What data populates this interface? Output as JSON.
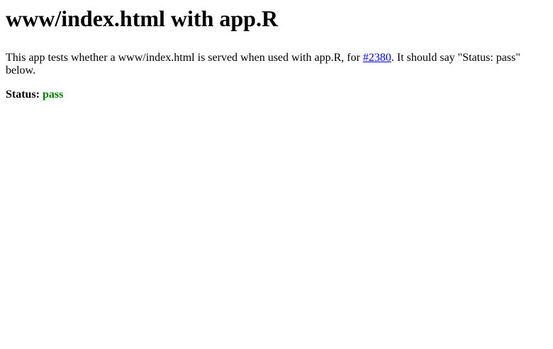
{
  "header": {
    "title": "www/index.html with app.R"
  },
  "intro": {
    "text_before": "This app tests whether a www/index.html is served when used with app.R, for ",
    "link_text": "#2380",
    "text_after": ". It should say \"Status: pass\" below."
  },
  "status": {
    "label": "Status:",
    "value": "pass"
  },
  "colors": {
    "link": "#0000ee",
    "pass": "#008000"
  }
}
